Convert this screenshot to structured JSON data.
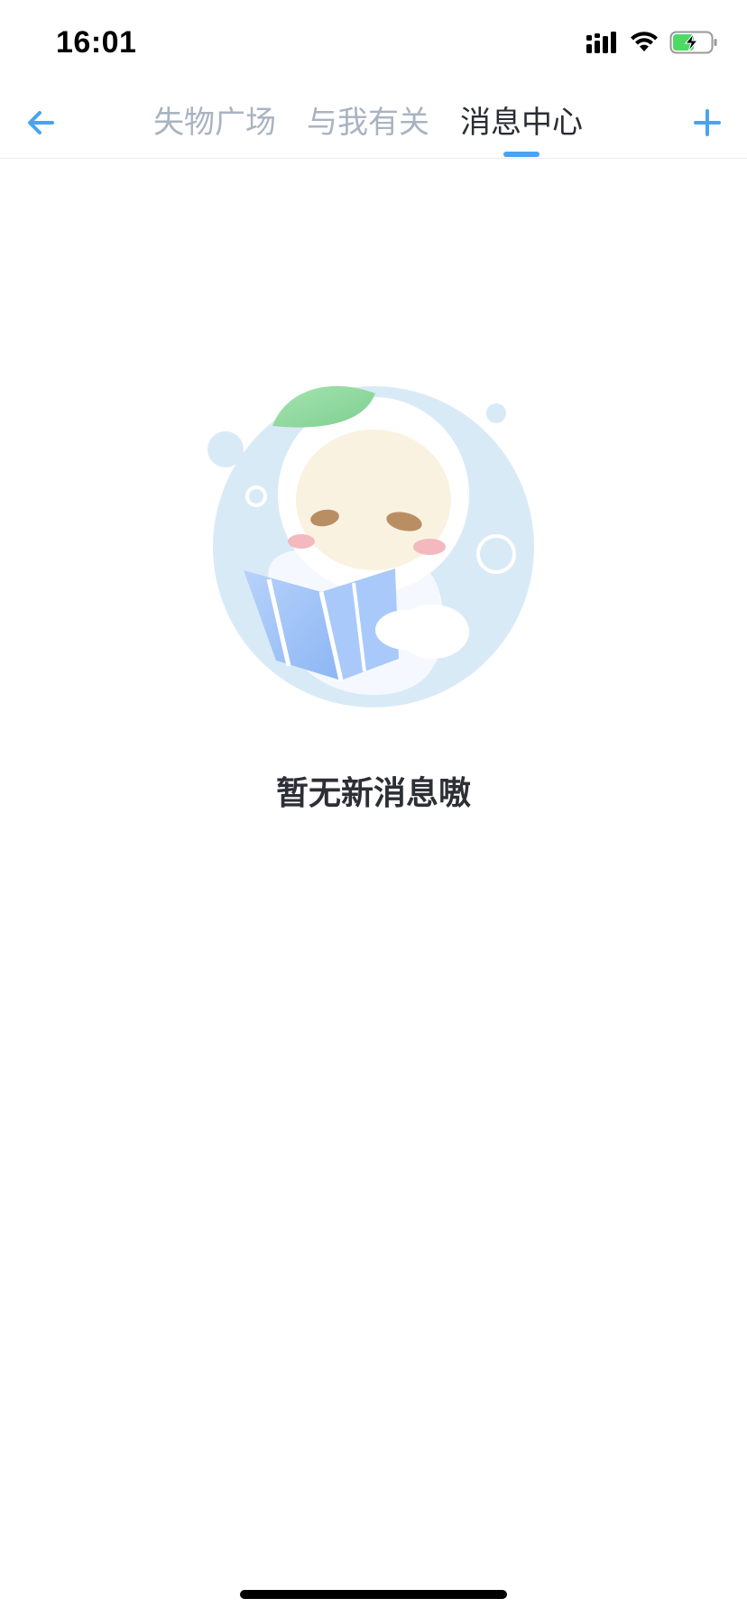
{
  "status_bar": {
    "time": "16:01",
    "icons": [
      "signal-icon",
      "wifi-icon",
      "battery-charging-icon"
    ],
    "battery_color": "#4cd964"
  },
  "nav": {
    "back_icon": "arrow-left-icon",
    "add_icon": "plus-icon",
    "accent_color": "#4aa3f0",
    "tabs": [
      {
        "label": "失物广场",
        "active": false
      },
      {
        "label": "与我有关",
        "active": false
      },
      {
        "label": "消息中心",
        "active": true
      }
    ]
  },
  "empty_state": {
    "illustration": "reading-mascot-illustration",
    "message": "暂无新消息嗷"
  }
}
